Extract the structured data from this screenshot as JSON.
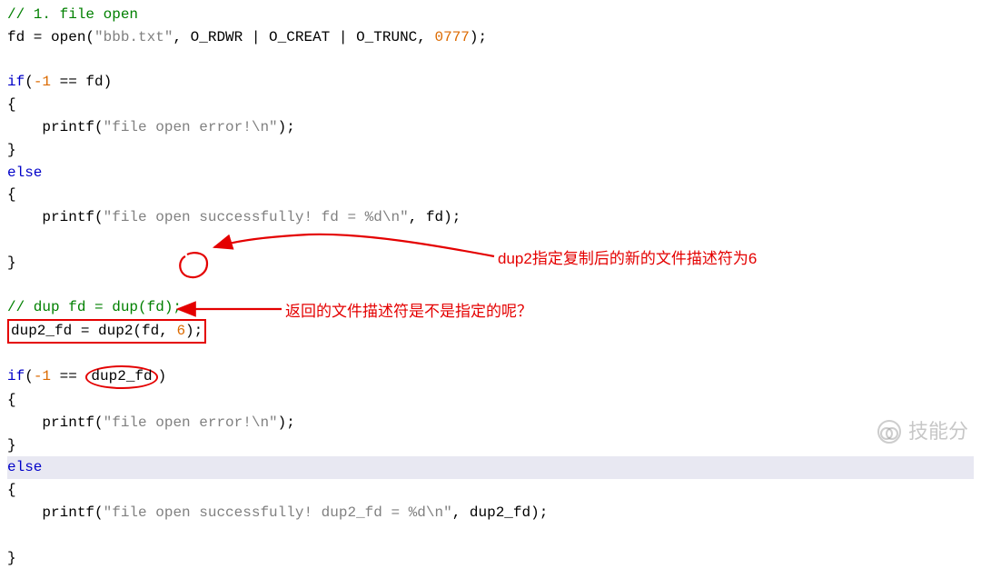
{
  "comments": {
    "c1": "// 1. file open",
    "c2": "// dup fd = dup(fd);"
  },
  "code": {
    "fdAssign_pre": "fd = open(",
    "fdAssign_str": "\"bbb.txt\"",
    "fdAssign_mid": ", O_RDWR | O_CREAT | O_TRUNC, ",
    "fdAssign_num": "0777",
    "fdAssign_end": ");",
    "if1_kw": "if",
    "if1_open": "(",
    "if1_neg1": "-1",
    "if1_mid": " == fd)",
    "brace_open": "{",
    "brace_close": "}",
    "printf_indent": "    ",
    "printf_name": "printf",
    "printf_open": "(",
    "err1_str": "\"file open error!\\n\"",
    "printf_close": ");",
    "else_kw": "else",
    "ok1_str": "\"file open successfully! fd = %d\\n\"",
    "ok1_tail": ", fd);",
    "dup2_line_pre": "dup2_fd = dup2(fd, ",
    "dup2_arg": "6",
    "dup2_line_post": ");",
    "if2_open": "(",
    "if2_neg1": "-1",
    "if2_mid": " == ",
    "if2_dup2fd": "dup2_fd",
    "if2_close": ")",
    "err2_str": "\"file open error!\\n\"",
    "ok2_str": "\"file open successfully! dup2_fd = %d\\n\"",
    "ok2_tail": ", dup2_fd);"
  },
  "annotations": {
    "a1": "dup2指定复制后的新的文件描述符为6",
    "a2": "返回的文件描述符是不是指定的呢？"
  },
  "colors": {
    "red": "#E40000",
    "comment": "#008000",
    "keyword": "#0000C8",
    "number": "#DC6A00",
    "string": "#808080"
  },
  "watermark": "技能分"
}
